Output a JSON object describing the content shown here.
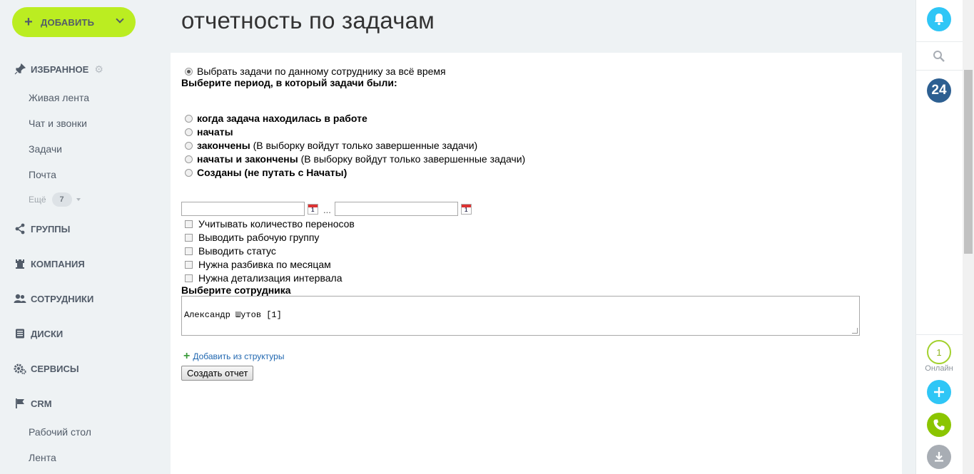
{
  "sidebar": {
    "add_label": "ДОБАВИТЬ",
    "favorites": {
      "label": "ИЗБРАННОЕ",
      "items": [
        "Живая лента",
        "Чат и звонки",
        "Задачи",
        "Почта"
      ]
    },
    "more_label": "Ещё",
    "more_count": "7",
    "sections": [
      "ГРУППЫ",
      "КОМПАНИЯ",
      "СОТРУДНИКИ",
      "ДИСКИ",
      "СЕРВИСЫ",
      "CRM"
    ],
    "crm_items": [
      "Рабочий стол",
      "Лента"
    ]
  },
  "page": {
    "title": "отчетность по задачам"
  },
  "form": {
    "all_time_label": "Выбрать задачи по данному сотруднику за всё время",
    "period_heading": "Выберите период, в который задачи были:",
    "period_options": [
      {
        "label": "когда задача находилась в работе",
        "hint": ""
      },
      {
        "label": "начаты",
        "hint": ""
      },
      {
        "label": "закончены",
        "hint": " (В выборку войдут только завершенные задачи)"
      },
      {
        "label": "начаты и закончены",
        "hint": " (В выборку войдут только завершенные задачи)"
      },
      {
        "label": "Созданы (не путать с Начаты)",
        "hint": ""
      }
    ],
    "date_from": "",
    "date_to": "",
    "date_separator": "...",
    "calendar_day": "1",
    "checkboxes": [
      "Учитывать количество переносов",
      "Выводить рабочую группу",
      "Выводить статус",
      "Нужна разбивка по месяцам",
      "Нужна детализация интервала"
    ],
    "employee_heading": "Выберите сотрудника",
    "employee_value": "Александр Шутов [1]",
    "add_from_structure": "Добавить из структуры",
    "submit_label": "Создать отчет"
  },
  "rightbar": {
    "logo_text": "24",
    "online_count": "1",
    "online_label": "Онлайн"
  },
  "colors": {
    "accent_green": "#bbed21",
    "bell_blue": "#2fc6f6",
    "logo_blue": "#2d5f91",
    "phone_green": "#8bc500",
    "download_gray": "#a8adb4"
  }
}
